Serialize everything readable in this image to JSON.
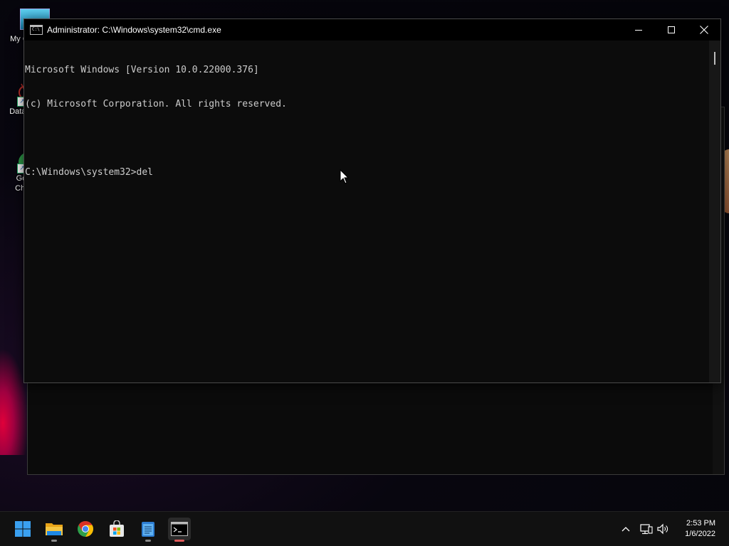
{
  "desktop": {
    "icons": [
      {
        "label": "My Co"
      },
      {
        "label": "DataW"
      },
      {
        "label": "Go\nChr"
      }
    ]
  },
  "cmd": {
    "title": "Administrator: C:\\Windows\\system32\\cmd.exe",
    "lines": [
      "Microsoft Windows [Version 10.0.22000.376]",
      "(c) Microsoft Corporation. All rights reserved.",
      "",
      "C:\\Windows\\system32>del"
    ],
    "icon_text": "C:\\"
  },
  "taskbar": {
    "apps": [
      {
        "name": "start",
        "icon": "windows-logo-icon"
      },
      {
        "name": "file-explorer",
        "icon": "folder-icon"
      },
      {
        "name": "chrome",
        "icon": "chrome-icon"
      },
      {
        "name": "microsoft-store",
        "icon": "store-icon"
      },
      {
        "name": "notepad",
        "icon": "notepad-icon"
      },
      {
        "name": "command-prompt",
        "icon": "terminal-icon",
        "active": true
      }
    ],
    "clock": {
      "time": "2:53 PM",
      "date": "1/6/2022"
    }
  },
  "colors": {
    "console_bg": "#0c0c0c",
    "console_fg": "#cccccc",
    "titlebar_bg": "#000000",
    "active_indicator": "#e05a5a",
    "win_blue": "#0078d4"
  }
}
